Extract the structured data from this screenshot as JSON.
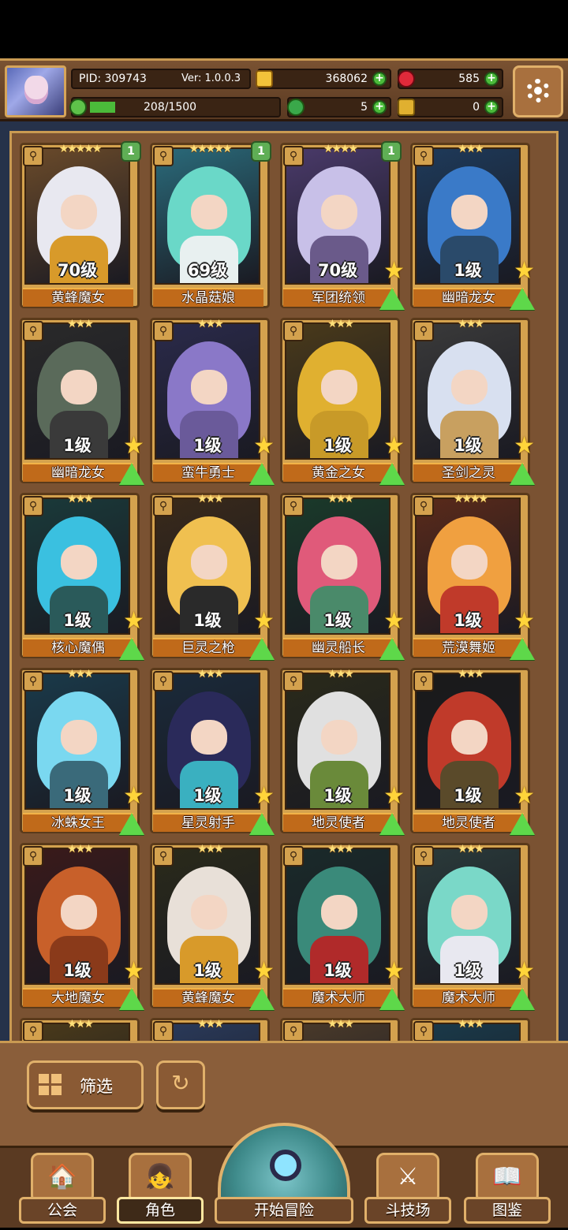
{
  "hud": {
    "pid": "PID: 309743",
    "version": "Ver: 1.0.0.3",
    "gold": "368062",
    "gems": "585",
    "stamina": "208/1500",
    "stamina_fraction": 0.139,
    "clover": "5",
    "keys": "0"
  },
  "cards": [
    {
      "stars": "★★★★★",
      "level": "70级",
      "name": "黄蜂魔女",
      "badge": "1",
      "upgrade": false,
      "palette": [
        "#6a4a2a",
        "#e8e8f0",
        "#d89a2a"
      ]
    },
    {
      "stars": "★★★★★",
      "level": "69级",
      "name": "水晶菇娘",
      "badge": "1",
      "upgrade": false,
      "palette": [
        "#2a6a7a",
        "#6ad8c8",
        "#e8f0f0"
      ]
    },
    {
      "stars": "★★★★",
      "level": "70级",
      "name": "军团统领",
      "badge": "1",
      "upgrade": true,
      "palette": [
        "#4a3a6a",
        "#c8c0e8",
        "#6a5a8a"
      ]
    },
    {
      "stars": "★★★",
      "level": "1级",
      "name": "幽暗龙女",
      "badge": "",
      "upgrade": true,
      "palette": [
        "#1e3a5a",
        "#3a7ac8",
        "#2a4a6a"
      ]
    },
    {
      "stars": "★★★",
      "level": "1级",
      "name": "幽暗龙女",
      "badge": "",
      "upgrade": true,
      "palette": [
        "#2a2a2a",
        "#5a6a5a",
        "#3a3a3a"
      ]
    },
    {
      "stars": "★★★",
      "level": "1级",
      "name": "蛮牛勇士",
      "badge": "",
      "upgrade": true,
      "palette": [
        "#2a2a4a",
        "#8a78c8",
        "#6a5a9a"
      ]
    },
    {
      "stars": "★★★",
      "level": "1级",
      "name": "黄金之女",
      "badge": "",
      "upgrade": true,
      "palette": [
        "#4a3a1a",
        "#e0b030",
        "#c89a28"
      ]
    },
    {
      "stars": "★★★",
      "level": "1级",
      "name": "圣剑之灵",
      "badge": "",
      "upgrade": true,
      "palette": [
        "#3a3a3a",
        "#d8e0f0",
        "#c8a060"
      ]
    },
    {
      "stars": "★★★",
      "level": "1级",
      "name": "核心魔偶",
      "badge": "",
      "upgrade": true,
      "palette": [
        "#1a3a3a",
        "#3ac0e0",
        "#2a5a5a"
      ]
    },
    {
      "stars": "★★★",
      "level": "1级",
      "name": "巨灵之枪",
      "badge": "",
      "upgrade": true,
      "palette": [
        "#3a2a1a",
        "#f0c050",
        "#2a2a2a"
      ]
    },
    {
      "stars": "★★★",
      "level": "1级",
      "name": "幽灵船长",
      "badge": "",
      "upgrade": true,
      "palette": [
        "#1a3a2a",
        "#e05a7a",
        "#4a8a6a"
      ]
    },
    {
      "stars": "★★★★",
      "level": "1级",
      "name": "荒漠舞姬",
      "badge": "",
      "upgrade": true,
      "palette": [
        "#5a2a1a",
        "#f0a040",
        "#c03a2a"
      ]
    },
    {
      "stars": "★★★",
      "level": "1级",
      "name": "冰蛛女王",
      "badge": "",
      "upgrade": true,
      "palette": [
        "#1a3a4a",
        "#7ad8f0",
        "#3a6a7a"
      ]
    },
    {
      "stars": "★★★",
      "level": "1级",
      "name": "星灵射手",
      "badge": "",
      "upgrade": true,
      "palette": [
        "#1a2a3a",
        "#2a2a5a",
        "#3ab0c0"
      ]
    },
    {
      "stars": "★★★",
      "level": "1级",
      "name": "地灵使者",
      "badge": "",
      "upgrade": true,
      "palette": [
        "#2a2a1a",
        "#e0e0e0",
        "#6a8a3a"
      ]
    },
    {
      "stars": "★★★",
      "level": "1级",
      "name": "地灵使者",
      "badge": "",
      "upgrade": true,
      "palette": [
        "#1a1a1a",
        "#c03a2a",
        "#5a4a2a"
      ]
    },
    {
      "stars": "★★★",
      "level": "1级",
      "name": "大地魔女",
      "badge": "",
      "upgrade": true,
      "palette": [
        "#3a1a1a",
        "#c8602a",
        "#8a3a1a"
      ]
    },
    {
      "stars": "★★★",
      "level": "1级",
      "name": "黄蜂魔女",
      "badge": "",
      "upgrade": true,
      "palette": [
        "#2a2a1a",
        "#e8e0d8",
        "#d89a2a"
      ]
    },
    {
      "stars": "★★★",
      "level": "1级",
      "name": "魔术大师",
      "badge": "",
      "upgrade": true,
      "palette": [
        "#1a2a2a",
        "#3a8a7a",
        "#b02a2a"
      ]
    },
    {
      "stars": "★★★",
      "level": "1级",
      "name": "魔术大师",
      "badge": "",
      "upgrade": true,
      "palette": [
        "#2a3a3a",
        "#7ad8c8",
        "#e8e8f0"
      ]
    },
    {
      "stars": "★★★",
      "level": "",
      "name": "",
      "badge": "",
      "upgrade": false,
      "palette": [
        "#4a3a1a",
        "#e0b030",
        "#6a4a2a"
      ]
    },
    {
      "stars": "★★★",
      "level": "",
      "name": "",
      "badge": "",
      "upgrade": false,
      "palette": [
        "#2a3a5a",
        "#8ac8f0",
        "#3a6a9a"
      ]
    },
    {
      "stars": "★★★",
      "level": "",
      "name": "",
      "badge": "",
      "upgrade": false,
      "palette": [
        "#4a3a2a",
        "#e8e0d0",
        "#8a6a4a"
      ]
    },
    {
      "stars": "★★★",
      "level": "",
      "name": "",
      "badge": "",
      "upgrade": false,
      "palette": [
        "#1a3a4a",
        "#5ac8e0",
        "#2a5a6a"
      ]
    }
  ],
  "controls": {
    "filter_label": "筛选",
    "reset_icon": "refresh-icon"
  },
  "nav": [
    {
      "label": "公会",
      "icon": "guild-icon",
      "glyph": "🏠"
    },
    {
      "label": "角色",
      "icon": "character-icon",
      "glyph": "👧"
    },
    {
      "label": "开始冒险",
      "icon": "adventure-icon",
      "glyph": ""
    },
    {
      "label": "斗技场",
      "icon": "arena-swords-icon",
      "glyph": "⚔"
    },
    {
      "label": "图鉴",
      "icon": "codex-book-icon",
      "glyph": "📖"
    }
  ],
  "active_nav": 1
}
